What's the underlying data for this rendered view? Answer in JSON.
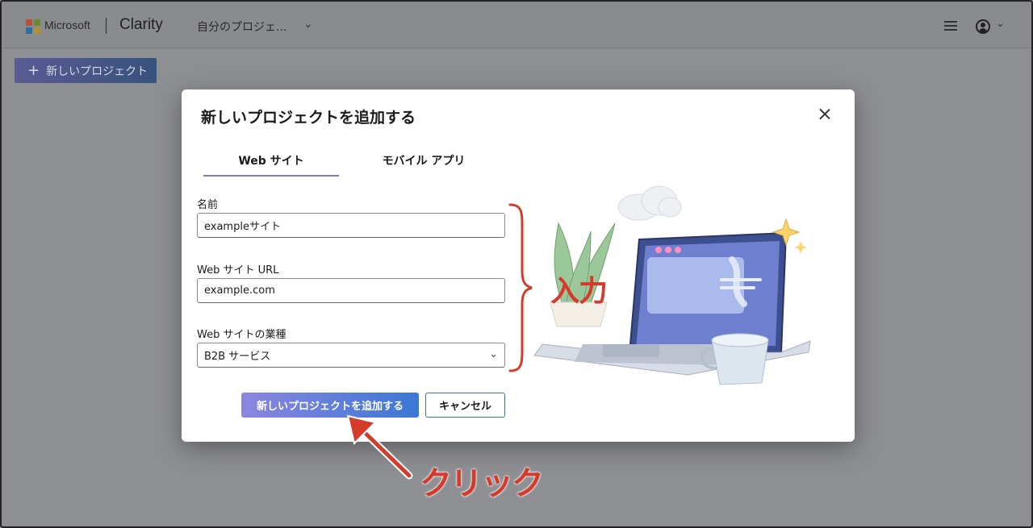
{
  "topbar": {
    "brand": "Microsoft",
    "product": "Clarity",
    "project_selector": "自分のプロジェ...",
    "menu_icon": "hamburger-icon",
    "user_icon": "user-icon"
  },
  "page": {
    "new_project_button": "新しいプロジェクト"
  },
  "modal": {
    "title": "新しいプロジェクトを追加する",
    "tabs": [
      {
        "label": "Web サイト",
        "selected": true
      },
      {
        "label": "モバイル アプリ",
        "selected": false
      }
    ],
    "fields": {
      "name_label": "名前",
      "name_value": "exampleサイト",
      "url_label": "Web サイト URL",
      "url_value": "example.com",
      "industry_label": "Web サイトの業種",
      "industry_value": "B2B サービス"
    },
    "primary_button": "新しいプロジェクトを追加する",
    "cancel_button": "キャンセル"
  },
  "annotations": {
    "input_label": "入力",
    "click_label": "クリック",
    "color": "#d43b2b"
  },
  "colors": {
    "accent": "#7b79d6",
    "primary_start": "#8b86e0",
    "primary_end": "#3a78d4",
    "overlay": "#8e8f93"
  }
}
